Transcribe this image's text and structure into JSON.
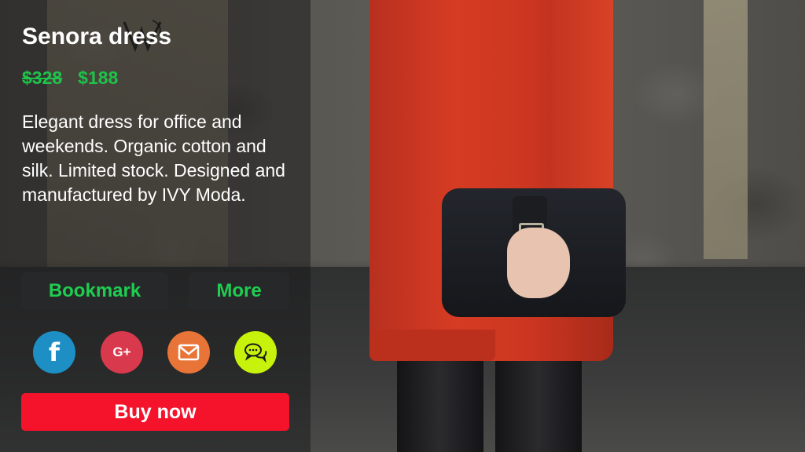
{
  "product": {
    "title": "Senora dress",
    "price_original": "$328",
    "price_sale": "$188",
    "description": "Elegant dress for office and weekends. Organic cotton and silk. Limited stock. Designed and manufactured by IVY Moda."
  },
  "actions": {
    "bookmark_label": "Bookmark",
    "more_label": "More",
    "buy_label": "Buy now"
  },
  "social": [
    {
      "icon": "facebook-icon",
      "glyph": "f",
      "color": "#1d8fc4"
    },
    {
      "icon": "google-plus-icon",
      "glyph": "G+",
      "color": "#d9394c"
    },
    {
      "icon": "mail-icon",
      "color": "#e87437"
    },
    {
      "icon": "chat-icon",
      "color": "#c6f20b"
    }
  ],
  "colors": {
    "price": "#1fc24a",
    "button_text": "#1fce4f",
    "buy_button": "#f5132c",
    "panel_overlay": "rgba(22,24,26,0.48)"
  }
}
